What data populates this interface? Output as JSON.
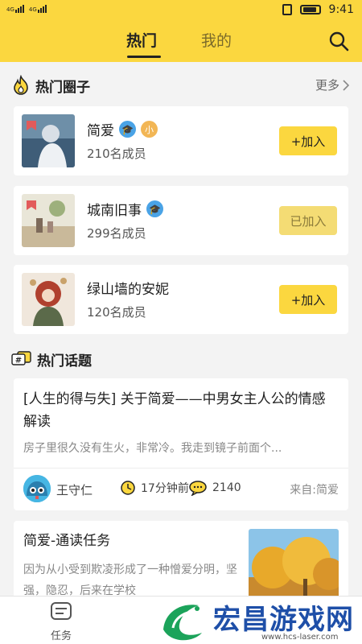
{
  "status_bar": {
    "signal_1": "4G",
    "signal_2": "4G",
    "time": "9:41"
  },
  "header": {
    "tabs": [
      {
        "label": "热门",
        "active": true
      },
      {
        "label": "我的",
        "active": false
      }
    ],
    "accent_color": "#fbd73f"
  },
  "hot_circles": {
    "title": "热门圈子",
    "more_label": "更多",
    "items": [
      {
        "name": "简爱",
        "badges": [
          "edu",
          "小"
        ],
        "members": "210名成员",
        "button": "+加入",
        "joined": false
      },
      {
        "name": "城南旧事",
        "badges": [
          "edu"
        ],
        "members": "299名成员",
        "button": "已加入",
        "joined": true
      },
      {
        "name": "绿山墙的安妮",
        "badges": [],
        "members": "120名成员",
        "button": "+加入",
        "joined": false
      }
    ]
  },
  "hot_topics": {
    "title": "热门话题",
    "topic": {
      "title": "[人生的得与失] 关于简爱——中男女主人公的情感解读",
      "excerpt": "房子里很久没有生火，非常冷。我走到镜子前面个...",
      "author": "王守仁",
      "time": "17分钟前",
      "replies": "2140",
      "source": "来自:简爱"
    },
    "task": {
      "title": "简爱-通读任务",
      "text": "因为从小受到欺凌形成了一种憎爱分明，坚强，隐忍，后来在学校"
    }
  },
  "bottom_nav": {
    "task_label": "任务"
  },
  "watermark": {
    "text": "宏昌游戏网",
    "url": "www.hcs-laser.com"
  }
}
